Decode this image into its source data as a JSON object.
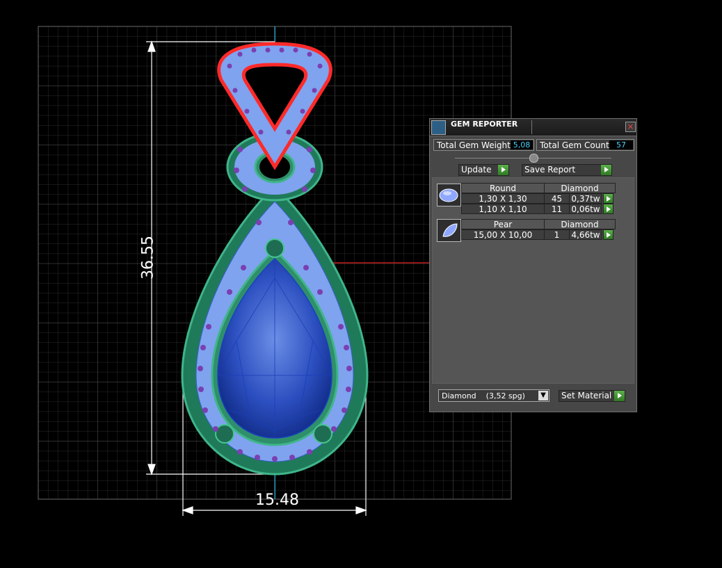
{
  "viewport": {
    "dimension_width": "15.48",
    "dimension_height": "36.55"
  },
  "panel": {
    "title": "GEM REPORTER",
    "total_weight_label": "Total Gem Weight",
    "total_weight_value": "5,08",
    "total_count_label": "Total Gem Count",
    "total_count_value": "57",
    "update_label": "Update",
    "save_report_label": "Save Report",
    "groups": [
      {
        "shape": "Round",
        "material": "Diamond",
        "rows": [
          {
            "size": "1,30 X 1,30",
            "count": "45",
            "weight": "0,37tw"
          },
          {
            "size": "1,10 X 1,10",
            "count": "11",
            "weight": "0,06tw"
          }
        ]
      },
      {
        "shape": "Pear",
        "material": "Diamond",
        "rows": [
          {
            "size": "15,00 X 10,00",
            "count": "1",
            "weight": "4,66tw"
          }
        ]
      }
    ],
    "material_select_value": "Diamond    (3,52 spg)",
    "set_material_label": "Set Material"
  },
  "colors": {
    "grid": "#3a3a3a",
    "metal": "#2f8f6a",
    "bail": "#ff2a2a",
    "gem": "#2d57c9",
    "pave": "#8fb0ff",
    "accent_value": "#4ad3ff",
    "button_green": "#4aa33a"
  }
}
